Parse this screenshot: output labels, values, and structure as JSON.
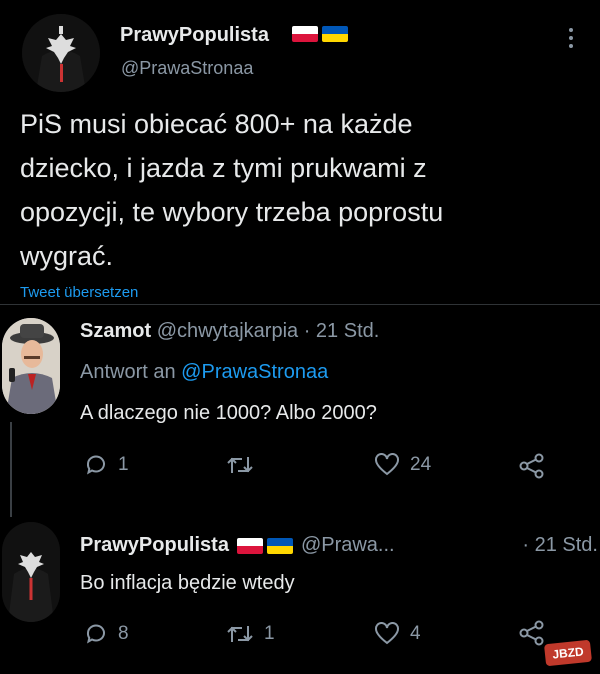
{
  "main_tweet": {
    "display_name": "PrawyPopulista",
    "handle": "@PrawaStronaa",
    "flags": [
      "pl-flag",
      "ua-flag"
    ],
    "text_lines": [
      "PiS musi obiecać 800+ na każde",
      "dziecko, i jazda z tymi prukwami z",
      "opozycji, te wybory trzeba poprostu",
      "wygrać."
    ],
    "translate_label": "Tweet übersetzen",
    "more_icon": "more-vertical-icon"
  },
  "reply1": {
    "display_name": "Szamot",
    "handle": "@chwytajkarpia",
    "time": "· 21 Std.",
    "reply_to_prefix": "Antwort an",
    "reply_to_handle": "@PrawaStronaa",
    "text": "A dlaczego nie 1000? Albo 2000?",
    "replies": "1",
    "retweets": "",
    "likes": "24"
  },
  "reply2": {
    "display_name": "PrawyPopulista",
    "handle": "@Prawa...",
    "time": "· 21 Std.",
    "text": "Bo inflacja będzie wtedy",
    "replies": "8",
    "retweets": "1",
    "likes": "4"
  },
  "watermark": "JBZD",
  "colors": {
    "background": "#000000",
    "text": "#e7e9ea",
    "secondary": "#8b98a5",
    "link": "#1d9bf0",
    "pl_red": "#dc143c",
    "ua_blue": "#0057b7",
    "ua_yellow": "#ffd700"
  }
}
